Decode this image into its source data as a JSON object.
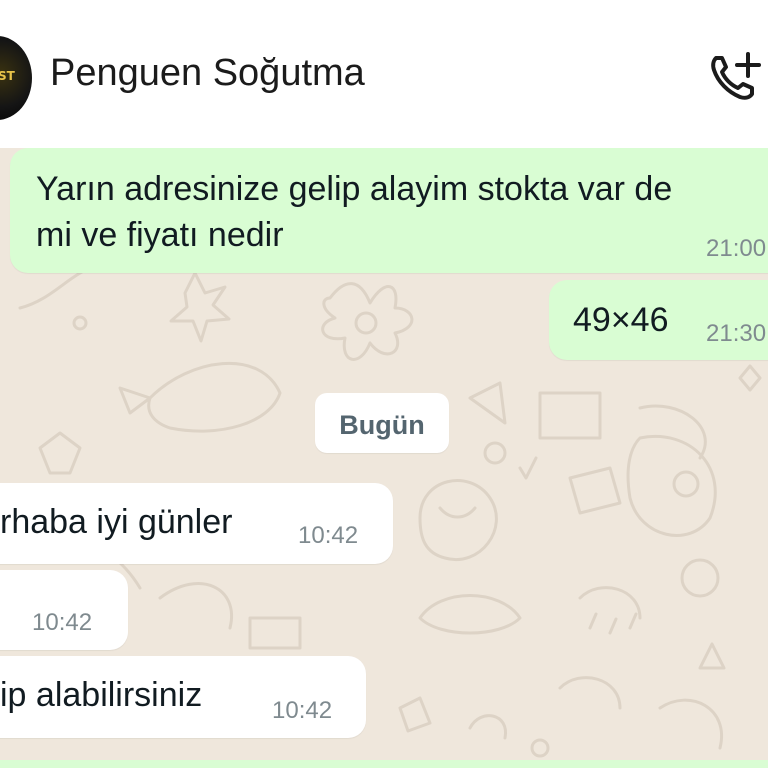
{
  "header": {
    "contact_name": "Penguen Soğutma",
    "avatar_text": "ST",
    "call_icon": "add-call-icon"
  },
  "date_separator": "Bugün",
  "messages": [
    {
      "direction": "outgoing",
      "lines": [
        "Yarın adresinize gelip alayim stokta var de",
        "mi ve fiyatı nedir"
      ],
      "time": "21:00"
    },
    {
      "direction": "outgoing",
      "lines": [
        "49×46"
      ],
      "time": "21:30"
    },
    {
      "direction": "incoming",
      "lines": [
        "rhaba iyi günler"
      ],
      "time": "10:42"
    },
    {
      "direction": "incoming",
      "lines": [
        ""
      ],
      "time": "10:42"
    },
    {
      "direction": "incoming",
      "lines": [
        "ip alabilirsiniz"
      ],
      "time": "10:42"
    }
  ],
  "colors": {
    "outgoing_bubble": "#d9fdd3",
    "incoming_bubble": "#ffffff",
    "chat_background": "#efe7dc",
    "doodle": "#ddd3c6"
  }
}
